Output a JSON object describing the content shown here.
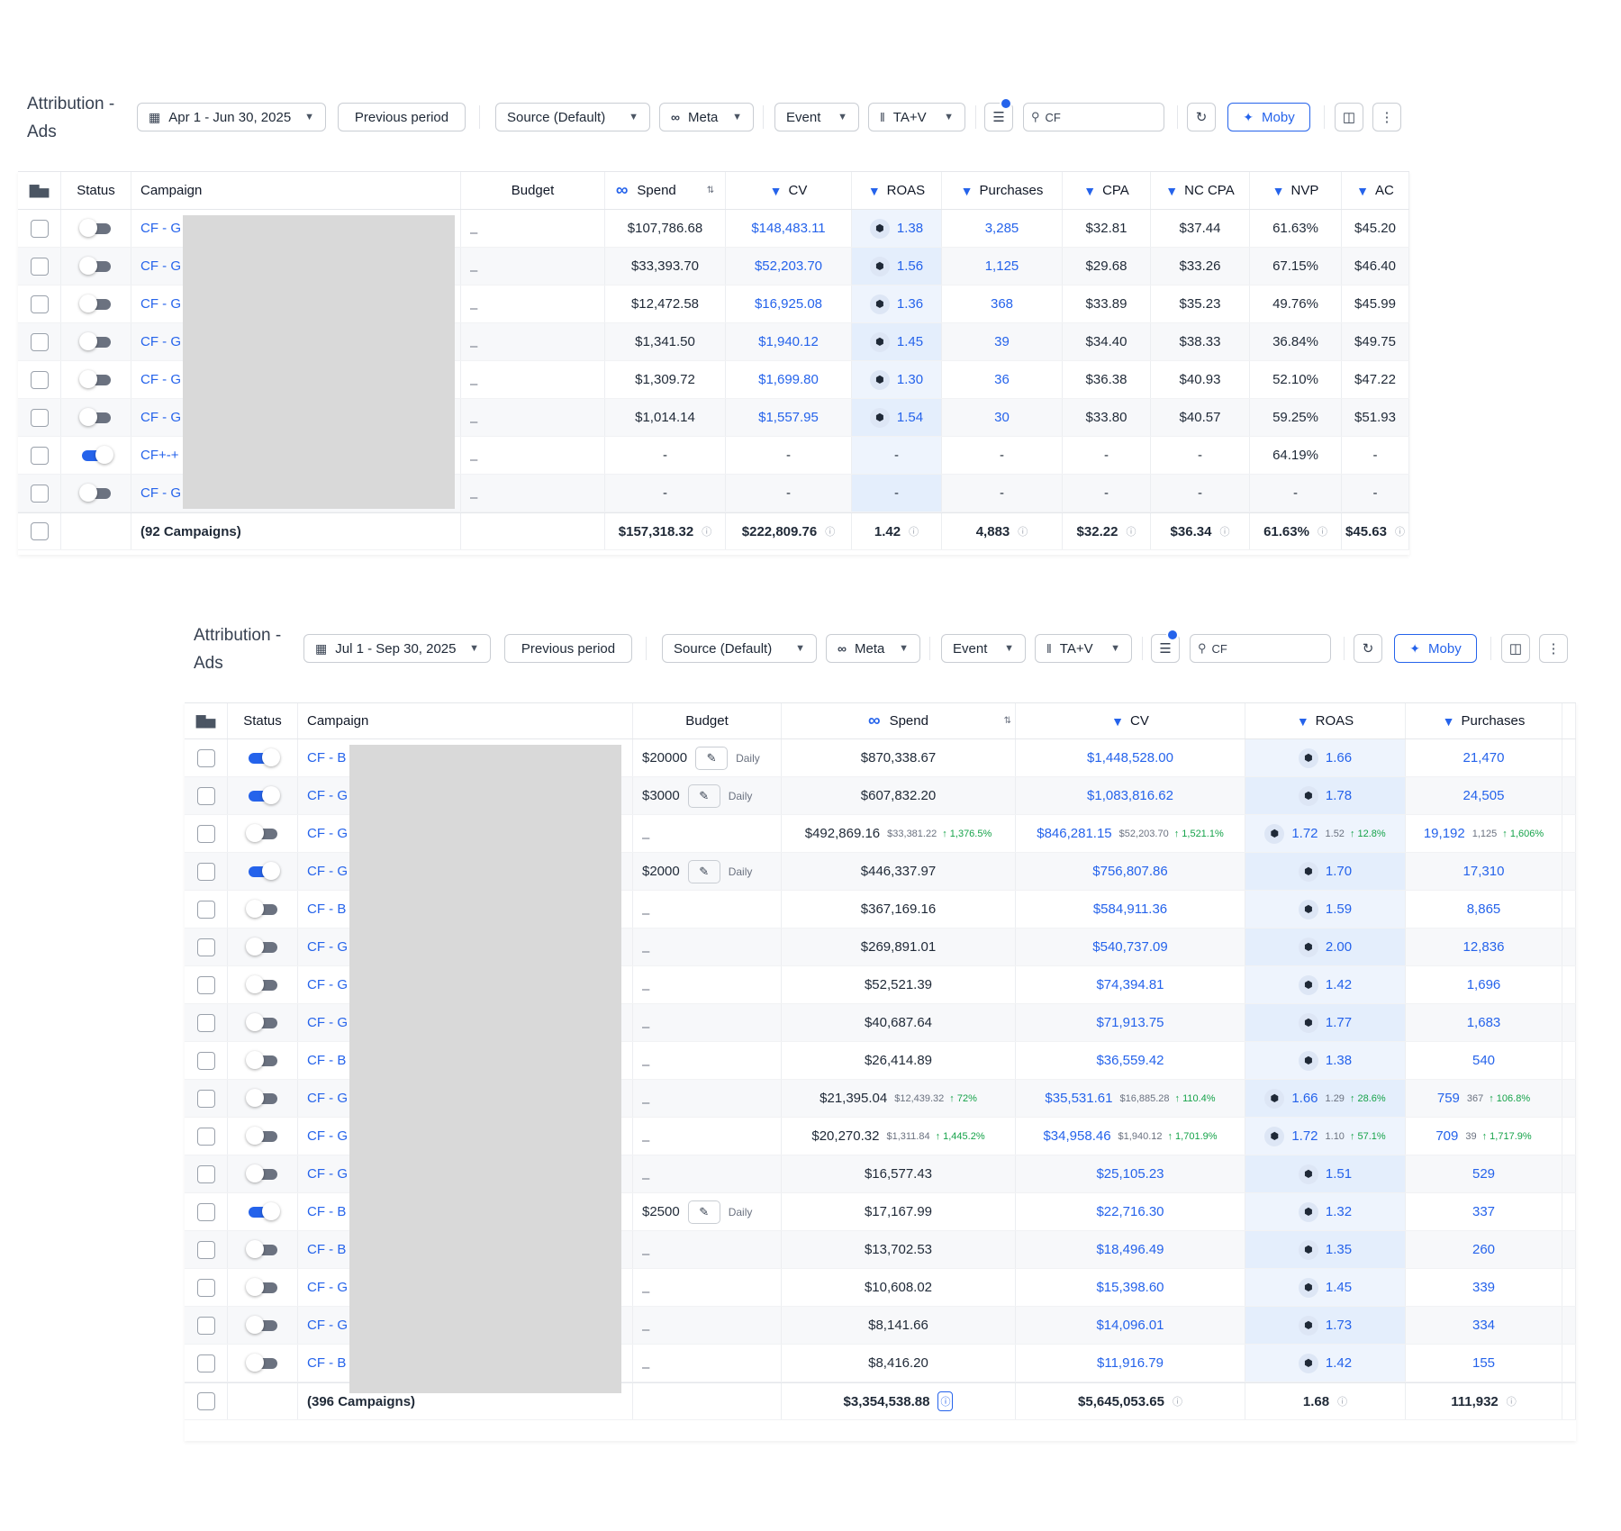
{
  "colors": {
    "accent": "#2563eb",
    "positive": "#16a34a",
    "redacted": "#d9d9d9"
  },
  "icons": [
    "calendar-icon",
    "chevron-down-icon",
    "meta-logo-icon",
    "columns-icon",
    "filter-icon",
    "search-icon",
    "refresh-icon",
    "sparkle-icon",
    "more-icon",
    "funnel-icon",
    "chart-icon",
    "sort-icon",
    "info-icon",
    "pencil-icon",
    "pixel-hex-icon",
    "arrow-up-icon"
  ],
  "p1": {
    "title": "Attribution - Ads",
    "date": "Apr 1 - Jun 30, 2025",
    "prev": "Previous period",
    "source": "Source (Default)",
    "platform": "Meta",
    "event": "Event",
    "model": "TA+V",
    "search": "CF",
    "moby": "Moby",
    "headers": {
      "status": "Status",
      "campaign": "Campaign",
      "budget": "Budget",
      "spend": "Spend",
      "cv": "CV",
      "roas": "ROAS",
      "purchases": "Purchases",
      "cpa": "CPA",
      "nccpa": "NC CPA",
      "nvp": "NVP",
      "ac": "AC"
    },
    "rows": [
      {
        "on": false,
        "name": "CF - G",
        "budget": "–",
        "spend": "$107,786.68",
        "cv": "$148,483.11",
        "roas": "1.38",
        "purch": "3,285",
        "cpa": "$32.81",
        "nccpa": "$37.44",
        "nvp": "61.63%",
        "ac": "$45.20"
      },
      {
        "on": false,
        "name": "CF - G",
        "budget": "–",
        "spend": "$33,393.70",
        "cv": "$52,203.70",
        "roas": "1.56",
        "purch": "1,125",
        "cpa": "$29.68",
        "nccpa": "$33.26",
        "nvp": "67.15%",
        "ac": "$46.40"
      },
      {
        "on": false,
        "name": "CF - G",
        "budget": "–",
        "spend": "$12,472.58",
        "cv": "$16,925.08",
        "roas": "1.36",
        "purch": "368",
        "cpa": "$33.89",
        "nccpa": "$35.23",
        "nvp": "49.76%",
        "ac": "$45.99"
      },
      {
        "on": false,
        "name": "CF - G",
        "budget": "–",
        "spend": "$1,341.50",
        "cv": "$1,940.12",
        "roas": "1.45",
        "purch": "39",
        "cpa": "$34.40",
        "nccpa": "$38.33",
        "nvp": "36.84%",
        "ac": "$49.75"
      },
      {
        "on": false,
        "name": "CF - G",
        "budget": "–",
        "spend": "$1,309.72",
        "cv": "$1,699.80",
        "roas": "1.30",
        "purch": "36",
        "cpa": "$36.38",
        "nccpa": "$40.93",
        "nvp": "52.10%",
        "ac": "$47.22"
      },
      {
        "on": false,
        "name": "CF - G",
        "budget": "–",
        "spend": "$1,014.14",
        "cv": "$1,557.95",
        "roas": "1.54",
        "purch": "30",
        "cpa": "$33.80",
        "nccpa": "$40.57",
        "nvp": "59.25%",
        "ac": "$51.93"
      },
      {
        "on": true,
        "name": "CF+-+",
        "budget": "–",
        "spend": "-",
        "cv": "-",
        "roas": "-",
        "purch": "-",
        "cpa": "-",
        "nccpa": "-",
        "nvp": "64.19%",
        "ac": "-"
      },
      {
        "on": false,
        "name": "CF - G",
        "budget": "–",
        "spend": "-",
        "cv": "-",
        "roas": "-",
        "purch": "-",
        "cpa": "-",
        "nccpa": "-",
        "nvp": "-",
        "ac": "-"
      }
    ],
    "total": {
      "label": "(92 Campaigns)",
      "spend": "$157,318.32",
      "cv": "$222,809.76",
      "roas": "1.42",
      "purch": "4,883",
      "cpa": "$32.22",
      "nccpa": "$36.34",
      "nvp": "61.63%",
      "ac": "$45.63"
    }
  },
  "p2": {
    "title": "Attribution - Ads",
    "date": "Jul 1 - Sep 30, 2025",
    "prev": "Previous period",
    "source": "Source (Default)",
    "platform": "Meta",
    "event": "Event",
    "model": "TA+V",
    "search": "CF",
    "moby": "Moby",
    "headers": {
      "status": "Status",
      "campaign": "Campaign",
      "budget": "Budget",
      "spend": "Spend",
      "cv": "CV",
      "roas": "ROAS",
      "purchases": "Purchases"
    },
    "daily": "Daily",
    "rows": [
      {
        "on": true,
        "name": "CF - B",
        "budget": "$20000",
        "spend": "$870,338.67",
        "cv": "$1,448,528.00",
        "roas": "1.66",
        "purch": "21,470"
      },
      {
        "on": true,
        "name": "CF - G",
        "budget": "$3000",
        "spend": "$607,832.20",
        "cv": "$1,083,816.62",
        "roas": "1.78",
        "purch": "24,505"
      },
      {
        "on": false,
        "name": "CF - G",
        "budget": "–",
        "spend": "$492,869.16",
        "spend_prev": "$33,381.22",
        "spend_chg": "1,376.5%",
        "cv": "$846,281.15",
        "cv_prev": "$52,203.70",
        "cv_chg": "1,521.1%",
        "roas": "1.72",
        "roas_prev": "1.52",
        "roas_chg": "12.8%",
        "purch": "19,192",
        "purch_prev": "1,125",
        "purch_chg": "1,606%"
      },
      {
        "on": true,
        "name": "CF - G",
        "budget": "$2000",
        "spend": "$446,337.97",
        "cv": "$756,807.86",
        "roas": "1.70",
        "purch": "17,310"
      },
      {
        "on": false,
        "name": "CF - B",
        "budget": "–",
        "spend": "$367,169.16",
        "cv": "$584,911.36",
        "roas": "1.59",
        "purch": "8,865"
      },
      {
        "on": false,
        "name": "CF - G",
        "budget": "–",
        "spend": "$269,891.01",
        "cv": "$540,737.09",
        "roas": "2.00",
        "purch": "12,836"
      },
      {
        "on": false,
        "name": "CF - G",
        "budget": "–",
        "spend": "$52,521.39",
        "cv": "$74,394.81",
        "roas": "1.42",
        "purch": "1,696"
      },
      {
        "on": false,
        "name": "CF - G",
        "budget": "–",
        "spend": "$40,687.64",
        "cv": "$71,913.75",
        "roas": "1.77",
        "purch": "1,683"
      },
      {
        "on": false,
        "name": "CF - B",
        "budget": "–",
        "spend": "$26,414.89",
        "cv": "$36,559.42",
        "roas": "1.38",
        "purch": "540"
      },
      {
        "on": false,
        "name": "CF - G",
        "budget": "–",
        "spend": "$21,395.04",
        "spend_prev": "$12,439.32",
        "spend_chg": "72%",
        "cv": "$35,531.61",
        "cv_prev": "$16,885.28",
        "cv_chg": "110.4%",
        "roas": "1.66",
        "roas_prev": "1.29",
        "roas_chg": "28.6%",
        "purch": "759",
        "purch_prev": "367",
        "purch_chg": "106.8%"
      },
      {
        "on": false,
        "name": "CF - G",
        "budget": "–",
        "spend": "$20,270.32",
        "spend_prev": "$1,311.84",
        "spend_chg": "1,445.2%",
        "cv": "$34,958.46",
        "cv_prev": "$1,940.12",
        "cv_chg": "1,701.9%",
        "roas": "1.72",
        "roas_prev": "1.10",
        "roas_chg": "57.1%",
        "purch": "709",
        "purch_prev": "39",
        "purch_chg": "1,717.9%"
      },
      {
        "on": false,
        "name": "CF - G",
        "budget": "–",
        "spend": "$16,577.43",
        "cv": "$25,105.23",
        "roas": "1.51",
        "purch": "529"
      },
      {
        "on": true,
        "name": "CF - B",
        "budget": "$2500",
        "spend": "$17,167.99",
        "cv": "$22,716.30",
        "roas": "1.32",
        "purch": "337"
      },
      {
        "on": false,
        "name": "CF - B",
        "budget": "–",
        "spend": "$13,702.53",
        "cv": "$18,496.49",
        "roas": "1.35",
        "purch": "260"
      },
      {
        "on": false,
        "name": "CF - G",
        "budget": "–",
        "spend": "$10,608.02",
        "cv": "$15,398.60",
        "roas": "1.45",
        "purch": "339"
      },
      {
        "on": false,
        "name": "CF - G",
        "budget": "–",
        "spend": "$8,141.66",
        "cv": "$14,096.01",
        "roas": "1.73",
        "purch": "334"
      },
      {
        "on": false,
        "name": "CF - B",
        "budget": "–",
        "spend": "$8,416.20",
        "cv": "$11,916.79",
        "roas": "1.42",
        "purch": "155"
      }
    ],
    "total": {
      "label": "(396 Campaigns)",
      "spend": "$3,354,538.88",
      "cv": "$5,645,053.65",
      "roas": "1.68",
      "purch": "111,932"
    }
  }
}
